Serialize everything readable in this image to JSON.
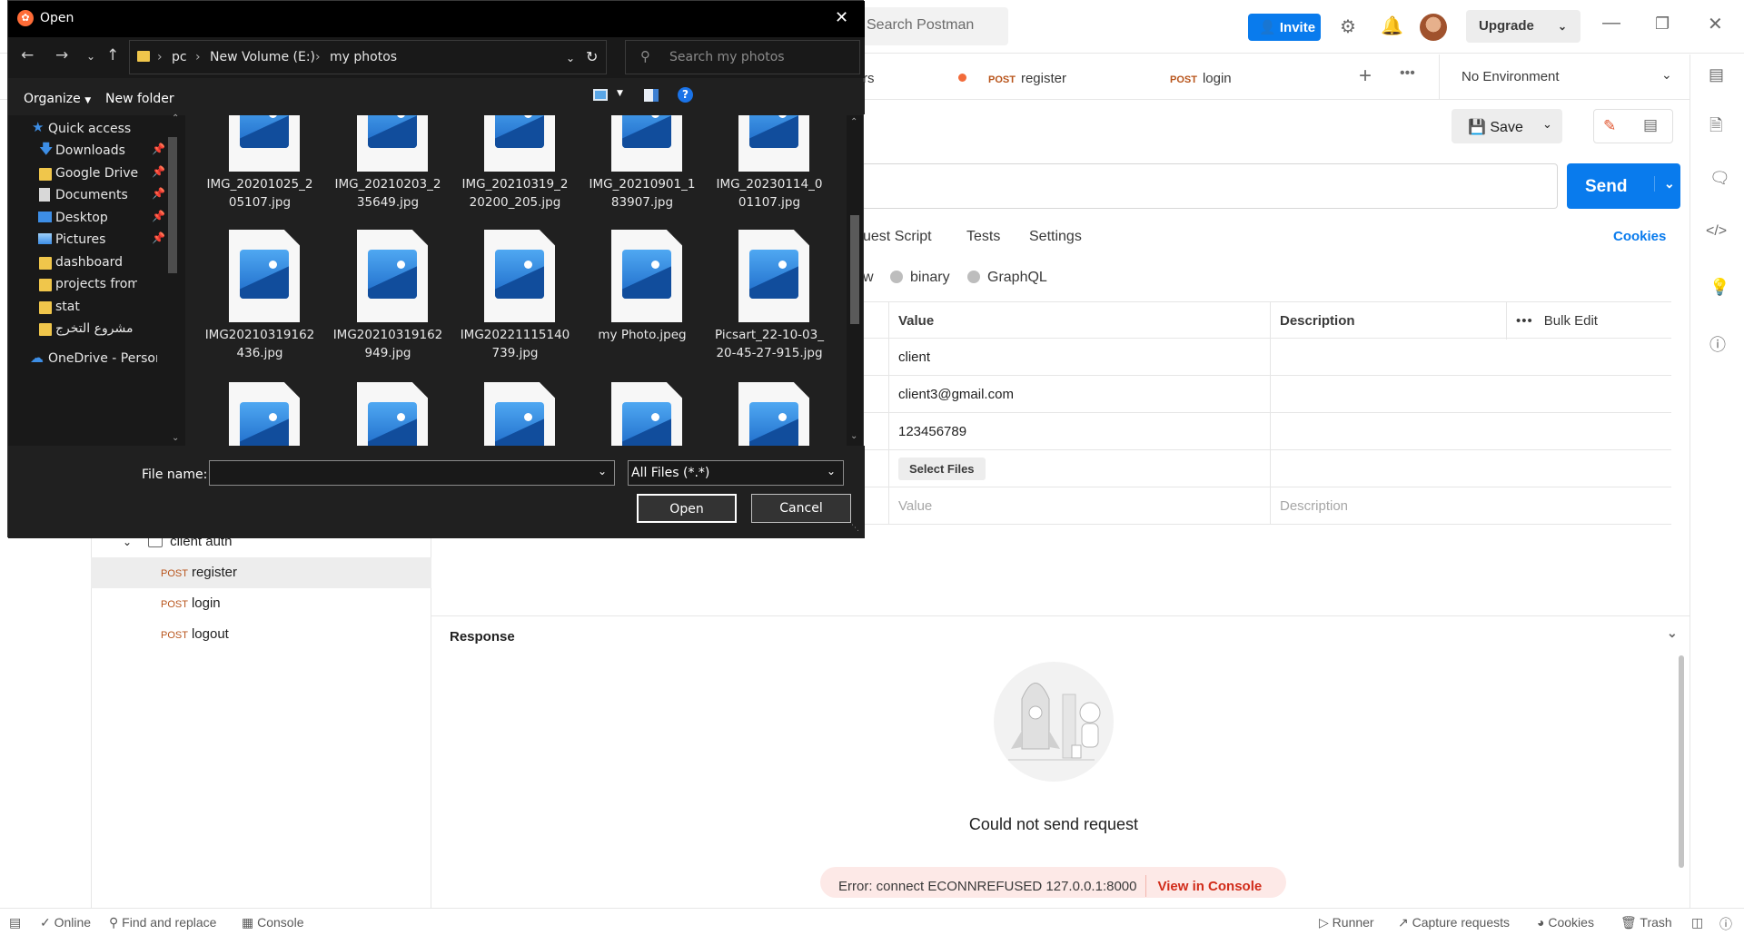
{
  "postman": {
    "search_placeholder": "Search Postman",
    "invite_label": "Invite",
    "upgrade_label": "Upgrade",
    "tabs": [
      {
        "text": "rs"
      },
      {
        "method": "POST",
        "name": "register"
      },
      {
        "method": "POST",
        "name": "login"
      }
    ],
    "environment": "No Environment",
    "save_label": "Save",
    "send_label": "Send",
    "subtabs": [
      "uest Script",
      "Tests",
      "Settings"
    ],
    "cookies_link": "Cookies",
    "body_types": [
      "w",
      "binary",
      "GraphQL"
    ],
    "table": {
      "headers": {
        "value": "Value",
        "description": "Description",
        "bulk_edit": "Bulk Edit"
      },
      "rows": [
        {
          "value": "client"
        },
        {
          "value": "client3@gmail.com"
        },
        {
          "value": "123456789"
        }
      ],
      "select_files": "Select Files",
      "value_placeholder": "Value",
      "description_placeholder": "Description"
    },
    "tree": {
      "folder": "client auth",
      "items": [
        {
          "method": "POST",
          "name": "register"
        },
        {
          "method": "POST",
          "name": "login"
        },
        {
          "method": "POST",
          "name": "logout"
        }
      ]
    },
    "response_title": "Response",
    "could_not_send": "Could not send request",
    "error_text": "Error: connect ECONNREFUSED 127.0.0.1:8000",
    "view_console": "View in Console",
    "status": {
      "online": "Online",
      "find_replace": "Find and replace",
      "console": "Console",
      "runner": "Runner",
      "capture": "Capture requests",
      "cookies": "Cookies",
      "trash": "Trash"
    }
  },
  "dialog": {
    "title": "Open",
    "breadcrumbs": [
      "pc",
      "New Volume (E:)",
      "my photos"
    ],
    "search_placeholder": "Search my photos",
    "organize": "Organize",
    "new_folder": "New folder",
    "nav": [
      {
        "label": "Quick access",
        "icon": "star-icon",
        "pinned": false
      },
      {
        "label": "Downloads",
        "icon": "download-icon",
        "pinned": true
      },
      {
        "label": "Google Drive",
        "icon": "folder-icon",
        "pinned": true
      },
      {
        "label": "Documents",
        "icon": "documents-icon",
        "pinned": true
      },
      {
        "label": "Desktop",
        "icon": "desktop-icon",
        "pinned": true
      },
      {
        "label": "Pictures",
        "icon": "pictures-icon",
        "pinned": true
      },
      {
        "label": "dashboard",
        "icon": "folder-icon",
        "pinned": false
      },
      {
        "label": "projects from git",
        "icon": "folder-icon",
        "pinned": false
      },
      {
        "label": "stat",
        "icon": "folder-icon",
        "pinned": false
      },
      {
        "label": "مشروع التخرج",
        "icon": "folder-icon",
        "pinned": false
      },
      {
        "label": "OneDrive - Person",
        "icon": "cloud-icon",
        "pinned": false
      }
    ],
    "files_row1": [
      "IMG_20201025_2\n05107.jpg",
      "IMG_20210203_2\n35649.jpg",
      "IMG_20210319_2\n20200_205.jpg",
      "IMG_20210901_1\n83907.jpg",
      "IMG_20230114_0\n01107.jpg"
    ],
    "files_row2": [
      "IMG20210319162\n436.jpg",
      "IMG20210319162\n949.jpg",
      "IMG20221115140\n739.jpg",
      "my Photo.jpeg",
      "Picsart_22-10-03_\n20-45-27-915.jpg"
    ],
    "file_name_label": "File name:",
    "file_name_value": "",
    "file_type": "All Files (*.*)",
    "open_label": "Open",
    "cancel_label": "Cancel"
  }
}
